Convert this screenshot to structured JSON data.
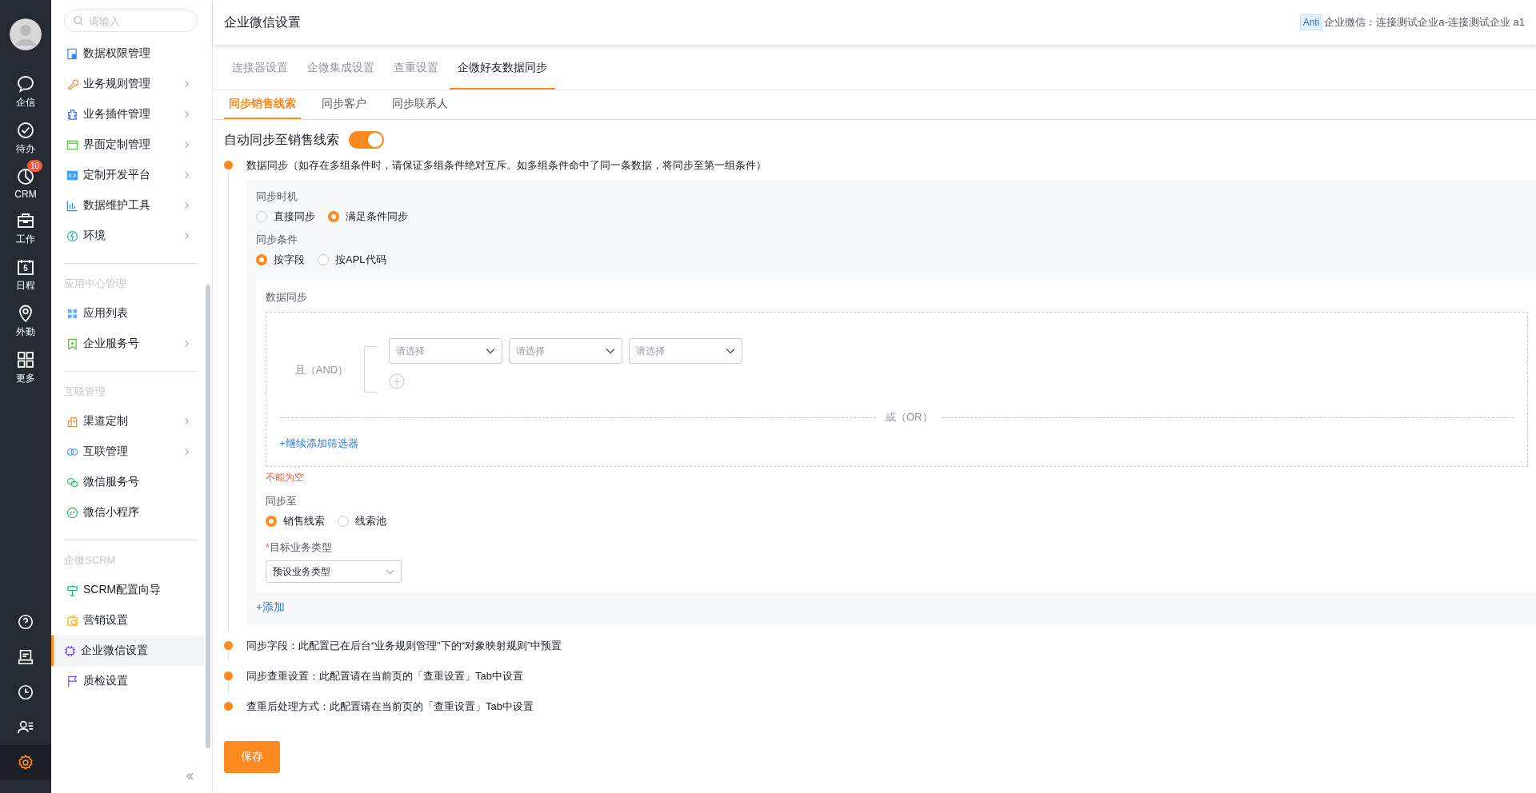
{
  "rail": {
    "items": [
      {
        "label": "企信"
      },
      {
        "label": "待办"
      },
      {
        "label": "CRM",
        "badge": "10"
      },
      {
        "label": "工作"
      },
      {
        "label": "日程",
        "icon_text": "5"
      },
      {
        "label": "外勤"
      },
      {
        "label": "更多"
      }
    ],
    "bottom_items": [
      {
        "selected": false
      },
      {
        "selected": false
      },
      {
        "selected": false
      },
      {
        "selected": false
      },
      {
        "selected": true
      }
    ]
  },
  "sidebar": {
    "search": {
      "placeholder": "请输入"
    },
    "sections": [
      {
        "items": [
          {
            "label": "数据权限管理",
            "has_submenu": false,
            "selected": false
          },
          {
            "label": "业务规则管理",
            "has_submenu": true,
            "selected": false
          },
          {
            "label": "业务插件管理",
            "has_submenu": true,
            "selected": false
          },
          {
            "label": "界面定制管理",
            "has_submenu": true,
            "selected": false
          },
          {
            "label": "定制开发平台",
            "has_submenu": true,
            "selected": false
          },
          {
            "label": "数据维护工具",
            "has_submenu": true,
            "selected": false
          },
          {
            "label": "环境",
            "has_submenu": true,
            "selected": false
          }
        ]
      },
      {
        "title": "应用中心管理",
        "items": [
          {
            "label": "应用列表",
            "has_submenu": false,
            "selected": false
          },
          {
            "label": "企业服务号",
            "has_submenu": true,
            "selected": false
          }
        ]
      },
      {
        "title": "互联管理",
        "items": [
          {
            "label": "渠道定制",
            "has_submenu": true,
            "selected": false
          },
          {
            "label": "互联管理",
            "has_submenu": true,
            "selected": false
          },
          {
            "label": "微信服务号",
            "has_submenu": false,
            "selected": false
          },
          {
            "label": "微信小程序",
            "has_submenu": false,
            "selected": false
          }
        ]
      },
      {
        "title": "企微SCRM",
        "items": [
          {
            "label": "SCRM配置向导",
            "has_submenu": false,
            "selected": false
          },
          {
            "label": "营销设置",
            "has_submenu": false,
            "selected": false
          },
          {
            "label": "企业微信设置",
            "has_submenu": false,
            "selected": true
          },
          {
            "label": "质检设置",
            "has_submenu": false,
            "selected": false
          }
        ]
      }
    ]
  },
  "header": {
    "title": "企业微信设置",
    "account_tag": "Anti",
    "account": "企业微信：连接测试企业a-连接测试企业 a1"
  },
  "tabs": [
    {
      "label": "连接器设置",
      "selected": false
    },
    {
      "label": "企微集成设置",
      "selected": false
    },
    {
      "label": "查重设置",
      "selected": false
    },
    {
      "label": "企微好友数据同步",
      "selected": true
    }
  ],
  "subtabs": [
    {
      "label": "同步销售线索",
      "selected": true
    },
    {
      "label": "同步客户",
      "selected": false
    },
    {
      "label": "同步联系人",
      "selected": false
    }
  ],
  "auto_sync": {
    "label": "自动同步至销售线索",
    "on": true
  },
  "steps": [
    {
      "text": "数据同步（如存在多组条件时，请保证多组条件绝对互斥。如多组条件命中了同一条数据，将同步至第一组条件）",
      "panel": {
        "timing": {
          "label": "同步时机",
          "options": [
            {
              "label": "直接同步",
              "selected": false
            },
            {
              "label": "满足条件同步",
              "selected": true
            }
          ]
        },
        "condition": {
          "label": "同步条件",
          "options": [
            {
              "label": "按字段",
              "selected": true
            },
            {
              "label": "按APL代码",
              "selected": false
            }
          ]
        },
        "filter": {
          "title": "数据同步",
          "and_label": "且（AND）",
          "selects": [
            {
              "placeholder": "请选择"
            },
            {
              "placeholder": "请选择"
            },
            {
              "placeholder": "请选择"
            }
          ],
          "or_label": "或（OR）",
          "add_filter": "+继续添加筛选器"
        },
        "error": "不能为空",
        "target": {
          "label": "同步至",
          "options": [
            {
              "label": "销售线索",
              "selected": true
            },
            {
              "label": "线索池",
              "selected": false
            }
          ]
        },
        "business_type": {
          "label": "目标业务类型",
          "required_mark": "*",
          "value": "预设业务类型"
        },
        "add": "+添加"
      }
    },
    {
      "text": "同步字段：此配置已在后台“业务规则管理”下的“对象映射规则”中预置"
    },
    {
      "text": "同步查重设置：此配置请在当前页的「查重设置」Tab中设置"
    },
    {
      "text": "查重后处理方式：此配置请在当前页的「查重设置」Tab中设置"
    }
  ],
  "save_button": "保存"
}
